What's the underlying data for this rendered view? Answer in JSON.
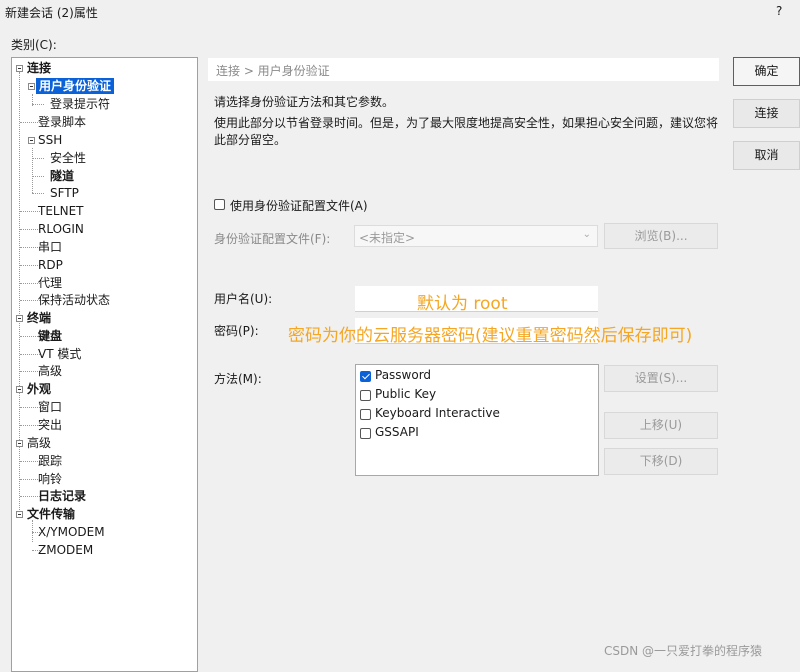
{
  "window": {
    "title": "新建会话 (2)属性",
    "help": "?"
  },
  "category_label": "类别(C):",
  "tree": {
    "items": [
      "连接",
      "用户身份验证",
      "登录提示符",
      "登录脚本",
      "SSH",
      "安全性",
      "隧道",
      "SFTP",
      "TELNET",
      "RLOGIN",
      "串口",
      "RDP",
      "代理",
      "保持活动状态",
      "终端",
      "键盘",
      "VT 模式",
      "高级",
      "外观",
      "窗口",
      "突出",
      "高级",
      "跟踪",
      "响铃",
      "日志记录",
      "文件传输",
      "X/YMODEM",
      "ZMODEM"
    ]
  },
  "breadcrumb": "连接 > 用户身份验证",
  "description": {
    "line1": "请选择身份验证方法和其它参数。",
    "line2": "使用此部分以节省登录时间。但是，为了最大限度地提高安全性，如果担心安全问题，建议您将此部分留空。"
  },
  "profile": {
    "checkbox_label": "使用身份验证配置文件(A)",
    "file_label": "身份验证配置文件(F):",
    "select_value": "<未指定>",
    "browse_label": "浏览(B)..."
  },
  "username": {
    "label": "用户名(U):",
    "value": "",
    "annotation": "默认为 root"
  },
  "password": {
    "label": "密码(P):",
    "value": "",
    "annotation": "密码为你的云服务器密码(建议重置密码然后保存即可)"
  },
  "method": {
    "label": "方法(M):",
    "items": [
      {
        "label": "Password",
        "checked": true
      },
      {
        "label": "Public Key",
        "checked": false
      },
      {
        "label": "Keyboard Interactive",
        "checked": false
      },
      {
        "label": "GSSAPI",
        "checked": false
      }
    ],
    "settings_label": "设置(S)...",
    "up_label": "上移(U)",
    "down_label": "下移(D)"
  },
  "dialog_buttons": {
    "ok": "确定",
    "connect": "连接",
    "cancel": "取消"
  },
  "watermark": "CSDN @一只爱打拳的程序猿",
  "colors": {
    "accent": "#0b61d8",
    "annotation": "#f5a623",
    "background": "#f0f0f0"
  }
}
